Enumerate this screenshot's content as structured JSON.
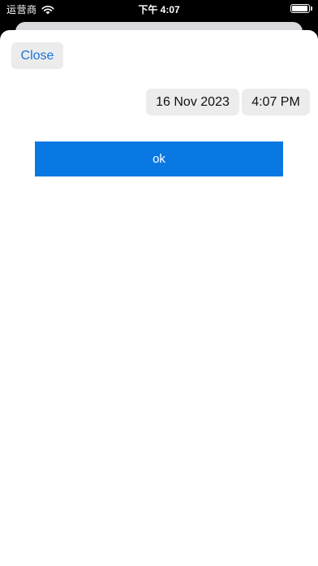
{
  "status_bar": {
    "carrier": "运营商",
    "time": "下午 4:07",
    "wifi_icon": "wifi-icon",
    "battery_icon": "battery-icon"
  },
  "sheet": {
    "close_label": "Close",
    "date_value": "16 Nov 2023",
    "time_value": "4:07 PM",
    "ok_label": "ok"
  },
  "colors": {
    "accent": "#0a78e3",
    "link": "#1a73d9",
    "chip_background": "#ececec"
  }
}
